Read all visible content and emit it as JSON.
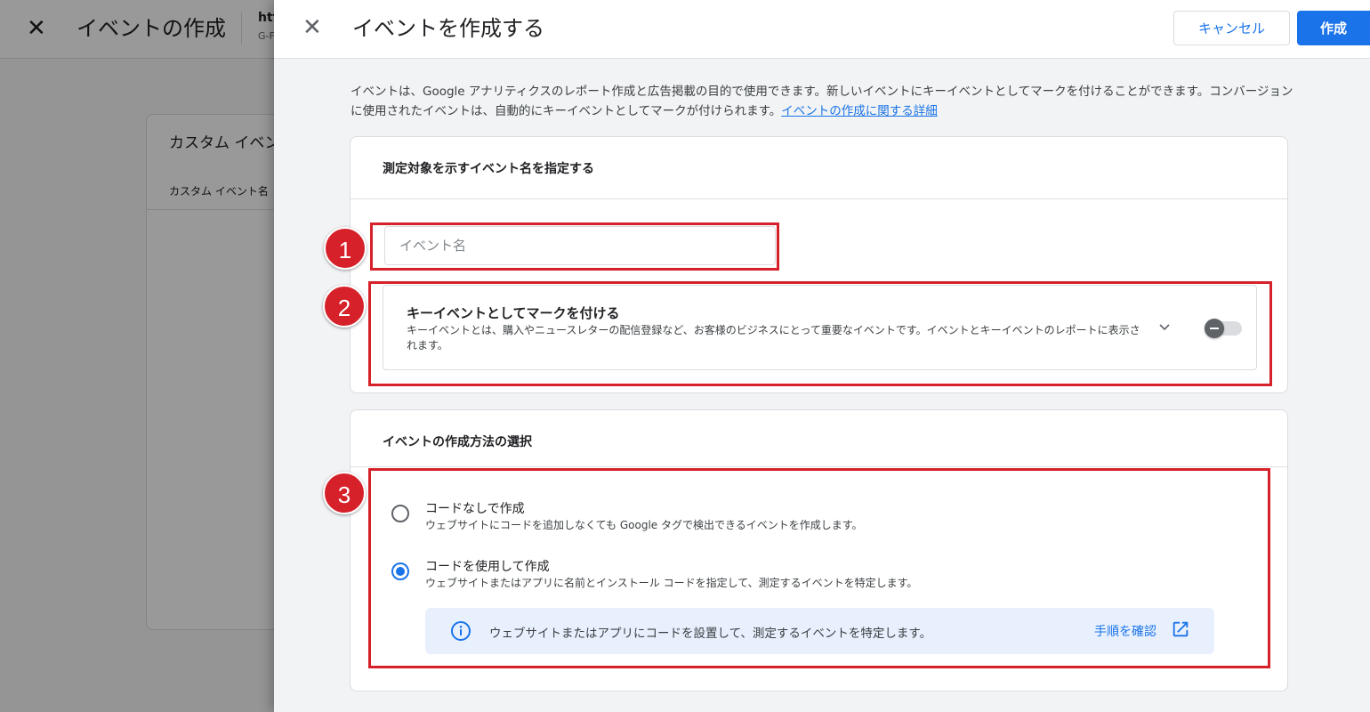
{
  "background": {
    "title": "イベントの作成",
    "property_name": "htt",
    "property_id": "G-F",
    "card_title": "カスタム イベン",
    "card_subtitle": "カスタム イベント名"
  },
  "drawer": {
    "title": "イベントを作成する",
    "cancel_label": "キャンセル",
    "create_label": "作成",
    "intro_text": "イベントは、Google アナリティクスのレポート作成と広告掲載の目的で使用できます。新しいイベントにキーイベントとしてマークを付けることができます。コンバージョンに使用されたイベントは、自動的にキーイベントとしてマークが付けられます。",
    "intro_link": "イベントの作成に関する詳細",
    "section1": {
      "heading": "測定対象を示すイベント名を指定する",
      "event_name_placeholder": "イベント名",
      "event_name_value": "",
      "key_event_title": "キーイベントとしてマークを付ける",
      "key_event_desc": "キーイベントとは、購入やニュースレターの配信登録など、お客様のビジネスにとって重要なイベントです。イベントとキーイベントのレポートに表示されます。",
      "key_event_enabled": false
    },
    "section2": {
      "heading": "イベントの作成方法の選択",
      "options": [
        {
          "label": "コードなしで作成",
          "desc": "ウェブサイトにコードを追加しなくても Google タグで検出できるイベントを作成します。",
          "selected": false
        },
        {
          "label": "コードを使用して作成",
          "desc": "ウェブサイトまたはアプリに名前とインストール コードを指定して、測定するイベントを特定します。",
          "selected": true
        }
      ],
      "info_text": "ウェブサイトまたはアプリにコードを設置して、測定するイベントを特定します。",
      "info_link": "手順を確認"
    }
  },
  "annotations": [
    "1",
    "2",
    "3"
  ],
  "colors": {
    "accent": "#1a73e8",
    "annotation": "#d6212a",
    "info_bg": "#e8f0fe"
  }
}
